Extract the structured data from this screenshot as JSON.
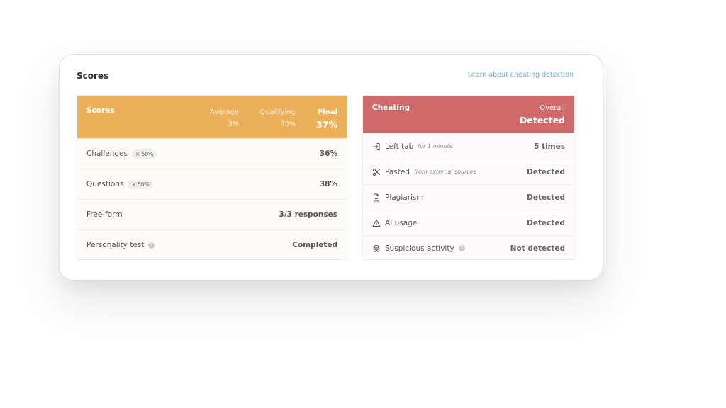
{
  "card": {
    "title": "Scores",
    "learn_link": "Learn about cheating detection"
  },
  "scores": {
    "header": {
      "title": "Scores",
      "average_label": "Average",
      "average_value": "3%",
      "qualifying_label": "Qualifying",
      "qualifying_value": "70%",
      "final_label": "Final",
      "final_value": "37%"
    },
    "rows": [
      {
        "label": "Challenges",
        "weight": "× 50%",
        "value": "36%"
      },
      {
        "label": "Questions",
        "weight": "× 50%",
        "value": "38%"
      },
      {
        "label": "Free-form",
        "value": "3/3 responses"
      },
      {
        "label": "Personality test",
        "help": "?",
        "value": "Completed"
      }
    ],
    "color": "#ecb05a"
  },
  "cheating": {
    "header": {
      "title": "Cheating",
      "overall_label": "Overall",
      "overall_value": "Detected"
    },
    "rows": [
      {
        "icon": "arrow-into-box-icon",
        "label": "Left tab",
        "note": "for 1 minute",
        "value": "5 times"
      },
      {
        "icon": "scissors-icon",
        "label": "Pasted",
        "note": "from external sources",
        "value": "Detected"
      },
      {
        "icon": "document-icon",
        "label": "Plagiarism",
        "value": "Detected"
      },
      {
        "icon": "warning-triangle-icon",
        "label": "AI usage",
        "value": "Detected"
      },
      {
        "icon": "spy-icon",
        "label": "Suspicious activity",
        "help": "?",
        "value": "Not detected"
      }
    ],
    "color": "#d16a6a"
  }
}
